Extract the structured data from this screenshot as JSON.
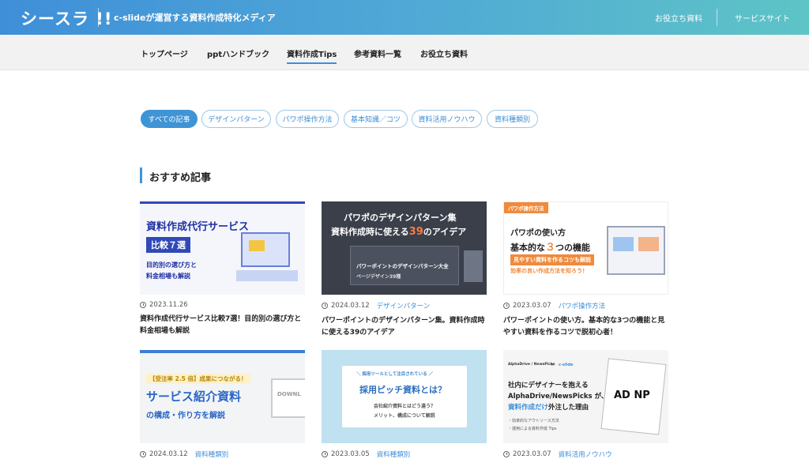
{
  "header": {
    "logo": "シースラ !!",
    "tagline": "c-slideが運営する資料作成特化メディア",
    "links": [
      "お役立ち資料",
      "サービスサイト"
    ]
  },
  "nav": {
    "items": [
      "トップページ",
      "pptハンドブック",
      "資料作成Tips",
      "参考資料一覧",
      "お役立ち資料"
    ],
    "active": "資料作成Tips"
  },
  "filters": {
    "items": [
      "すべての記事",
      "デザインパターン",
      "パワポ操作方法",
      "基本知識／コツ",
      "資料活用ノウハウ",
      "資料種類別"
    ],
    "active": "すべての記事"
  },
  "section": {
    "title": "おすすめ記事"
  },
  "cards": [
    {
      "date": "2023.11.26",
      "category": "",
      "title": "資料作成代行サービス比較7選！目的別の選び方と料金相場も解説",
      "thumb": {
        "line1": "資料作成代行サービス",
        "line2": "比較７選",
        "line3": "目的別の選び方と",
        "line4": "料金相場も解説"
      }
    },
    {
      "date": "2024.03.12",
      "category": "デザインパターン",
      "title": "パワーポイントのデザインパターン集。資料作成時に使える39のアイデア",
      "thumb": {
        "line1": "パワポのデザインパターン集",
        "line2": "資料作成時に使える",
        "line2b": "39",
        "line2c": "のアイデア",
        "badge": "パワーポイントのデザインパターン大全",
        "sub": "ページデザイン39種"
      }
    },
    {
      "date": "2023.03.07",
      "category": "パワポ操作方法",
      "title": "パワーポイントの使い方。基本的な3つの機能と見やすい資料を作るコツで脱初心者！",
      "thumb": {
        "tag": "パワポ操作方法",
        "line1": "パワポの使い方",
        "line2": "基本的な",
        "line2b": "３",
        "line2c": "つの機能",
        "line3": "見やすい資料を作るコツも解説",
        "line4": "効率の良い作成方法を知ろう！"
      }
    },
    {
      "date": "2024.03.12",
      "category": "資料種類別",
      "title": "",
      "thumb": {
        "line1": "【受注率 2.5 倍】成果につながる！",
        "line2": "サービス紹介資料",
        "line3": "の構成・作り方を解説",
        "side": "DOWNL"
      }
    },
    {
      "date": "2023.03.05",
      "category": "資料種類別",
      "title": "",
      "thumb": {
        "top": "＼ 採用ツールとして注目されている ／",
        "line1": "採用ピッチ資料とは？",
        "line2": "会社紹介資料とはどう違う？",
        "line3": "メリット、構成について解説"
      }
    },
    {
      "date": "2023.03.07",
      "category": "資料活用ノウハウ",
      "title": "",
      "thumb": {
        "brand": "AlphaDrive / NewsPicks",
        "x": "×",
        "cs": "c-slide",
        "line1": "社内にデザイナーを抱える",
        "line2": "AlphaDrive/NewsPicks が、",
        "line3a": "資料作成だけ",
        "line3b": "外注した理由",
        "b1": "・効率的なアウトソース方法",
        "b2": "・運用による資料作成 Tips",
        "logo": "AD NP"
      }
    }
  ],
  "colors": {
    "accent": "#3f94d6",
    "header_start": "#3f8fd8",
    "header_end": "#5ec4c6"
  },
  "icons": {
    "clock": "clock-icon"
  }
}
